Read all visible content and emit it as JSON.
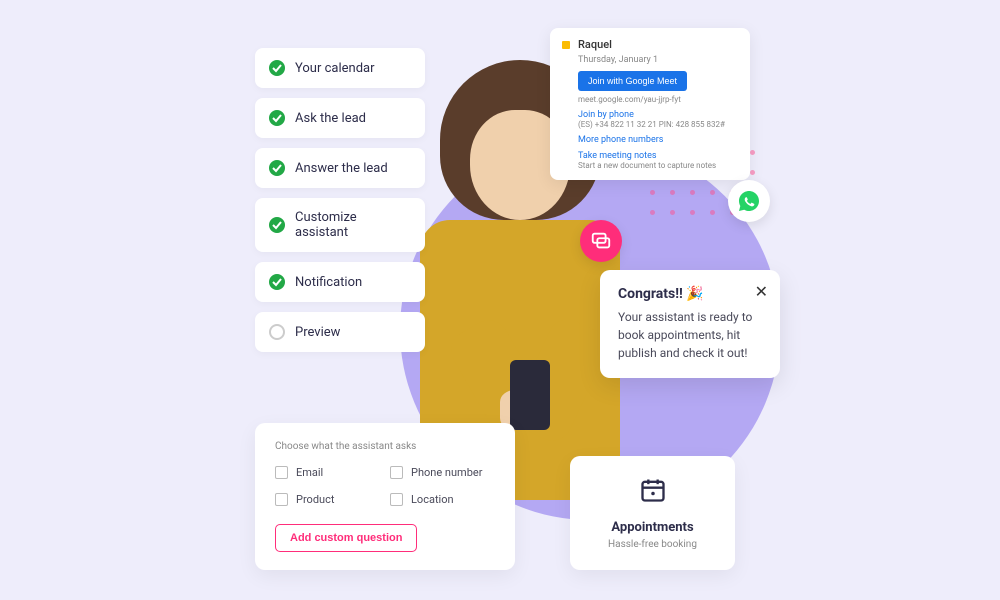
{
  "checklist": [
    {
      "label": "Your calendar",
      "done": true
    },
    {
      "label": "Ask the lead",
      "done": true
    },
    {
      "label": "Answer the lead",
      "done": true
    },
    {
      "label": "Customize assistant",
      "done": true
    },
    {
      "label": "Notification",
      "done": true
    },
    {
      "label": "Preview",
      "done": false
    }
  ],
  "calendar": {
    "name": "Raquel",
    "date": "Thursday, January 1",
    "join_button": "Join with Google Meet",
    "meet_url": "meet.google.com/yau-jjrp-fyt",
    "phone_label": "Join by phone",
    "phone_number": "(ES) +34 822 11 32 21 PIN: 428 855 832#",
    "more_phones": "More phone numbers",
    "notes_label": "Take meeting notes",
    "notes_sub": "Start a new document to capture notes"
  },
  "congrats": {
    "title": "Congrats!! 🎉",
    "body": "Your assistant is ready to book appointments, hit publish and check it out!"
  },
  "form": {
    "title": "Choose what the assistant asks",
    "options": [
      "Email",
      "Phone number",
      "Product",
      "Location"
    ],
    "add_button": "Add custom question"
  },
  "appointments": {
    "title": "Appointments",
    "subtitle": "Hassle-free booking"
  }
}
